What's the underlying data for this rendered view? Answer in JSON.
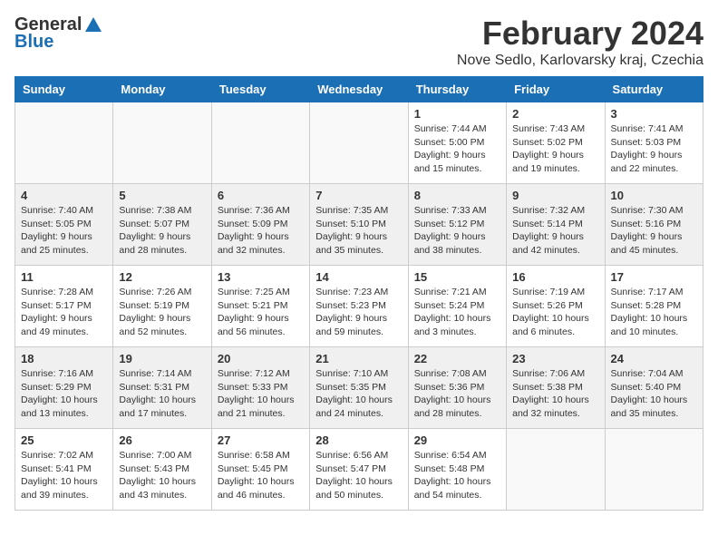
{
  "header": {
    "logo_line1": "General",
    "logo_line2": "Blue",
    "month": "February 2024",
    "location": "Nove Sedlo, Karlovarsky kraj, Czechia"
  },
  "days_of_week": [
    "Sunday",
    "Monday",
    "Tuesday",
    "Wednesday",
    "Thursday",
    "Friday",
    "Saturday"
  ],
  "weeks": [
    [
      {
        "day": "",
        "info": ""
      },
      {
        "day": "",
        "info": ""
      },
      {
        "day": "",
        "info": ""
      },
      {
        "day": "",
        "info": ""
      },
      {
        "day": "1",
        "info": "Sunrise: 7:44 AM\nSunset: 5:00 PM\nDaylight: 9 hours\nand 15 minutes."
      },
      {
        "day": "2",
        "info": "Sunrise: 7:43 AM\nSunset: 5:02 PM\nDaylight: 9 hours\nand 19 minutes."
      },
      {
        "day": "3",
        "info": "Sunrise: 7:41 AM\nSunset: 5:03 PM\nDaylight: 9 hours\nand 22 minutes."
      }
    ],
    [
      {
        "day": "4",
        "info": "Sunrise: 7:40 AM\nSunset: 5:05 PM\nDaylight: 9 hours\nand 25 minutes."
      },
      {
        "day": "5",
        "info": "Sunrise: 7:38 AM\nSunset: 5:07 PM\nDaylight: 9 hours\nand 28 minutes."
      },
      {
        "day": "6",
        "info": "Sunrise: 7:36 AM\nSunset: 5:09 PM\nDaylight: 9 hours\nand 32 minutes."
      },
      {
        "day": "7",
        "info": "Sunrise: 7:35 AM\nSunset: 5:10 PM\nDaylight: 9 hours\nand 35 minutes."
      },
      {
        "day": "8",
        "info": "Sunrise: 7:33 AM\nSunset: 5:12 PM\nDaylight: 9 hours\nand 38 minutes."
      },
      {
        "day": "9",
        "info": "Sunrise: 7:32 AM\nSunset: 5:14 PM\nDaylight: 9 hours\nand 42 minutes."
      },
      {
        "day": "10",
        "info": "Sunrise: 7:30 AM\nSunset: 5:16 PM\nDaylight: 9 hours\nand 45 minutes."
      }
    ],
    [
      {
        "day": "11",
        "info": "Sunrise: 7:28 AM\nSunset: 5:17 PM\nDaylight: 9 hours\nand 49 minutes."
      },
      {
        "day": "12",
        "info": "Sunrise: 7:26 AM\nSunset: 5:19 PM\nDaylight: 9 hours\nand 52 minutes."
      },
      {
        "day": "13",
        "info": "Sunrise: 7:25 AM\nSunset: 5:21 PM\nDaylight: 9 hours\nand 56 minutes."
      },
      {
        "day": "14",
        "info": "Sunrise: 7:23 AM\nSunset: 5:23 PM\nDaylight: 9 hours\nand 59 minutes."
      },
      {
        "day": "15",
        "info": "Sunrise: 7:21 AM\nSunset: 5:24 PM\nDaylight: 10 hours\nand 3 minutes."
      },
      {
        "day": "16",
        "info": "Sunrise: 7:19 AM\nSunset: 5:26 PM\nDaylight: 10 hours\nand 6 minutes."
      },
      {
        "day": "17",
        "info": "Sunrise: 7:17 AM\nSunset: 5:28 PM\nDaylight: 10 hours\nand 10 minutes."
      }
    ],
    [
      {
        "day": "18",
        "info": "Sunrise: 7:16 AM\nSunset: 5:29 PM\nDaylight: 10 hours\nand 13 minutes."
      },
      {
        "day": "19",
        "info": "Sunrise: 7:14 AM\nSunset: 5:31 PM\nDaylight: 10 hours\nand 17 minutes."
      },
      {
        "day": "20",
        "info": "Sunrise: 7:12 AM\nSunset: 5:33 PM\nDaylight: 10 hours\nand 21 minutes."
      },
      {
        "day": "21",
        "info": "Sunrise: 7:10 AM\nSunset: 5:35 PM\nDaylight: 10 hours\nand 24 minutes."
      },
      {
        "day": "22",
        "info": "Sunrise: 7:08 AM\nSunset: 5:36 PM\nDaylight: 10 hours\nand 28 minutes."
      },
      {
        "day": "23",
        "info": "Sunrise: 7:06 AM\nSunset: 5:38 PM\nDaylight: 10 hours\nand 32 minutes."
      },
      {
        "day": "24",
        "info": "Sunrise: 7:04 AM\nSunset: 5:40 PM\nDaylight: 10 hours\nand 35 minutes."
      }
    ],
    [
      {
        "day": "25",
        "info": "Sunrise: 7:02 AM\nSunset: 5:41 PM\nDaylight: 10 hours\nand 39 minutes."
      },
      {
        "day": "26",
        "info": "Sunrise: 7:00 AM\nSunset: 5:43 PM\nDaylight: 10 hours\nand 43 minutes."
      },
      {
        "day": "27",
        "info": "Sunrise: 6:58 AM\nSunset: 5:45 PM\nDaylight: 10 hours\nand 46 minutes."
      },
      {
        "day": "28",
        "info": "Sunrise: 6:56 AM\nSunset: 5:47 PM\nDaylight: 10 hours\nand 50 minutes."
      },
      {
        "day": "29",
        "info": "Sunrise: 6:54 AM\nSunset: 5:48 PM\nDaylight: 10 hours\nand 54 minutes."
      },
      {
        "day": "",
        "info": ""
      },
      {
        "day": "",
        "info": ""
      }
    ]
  ]
}
